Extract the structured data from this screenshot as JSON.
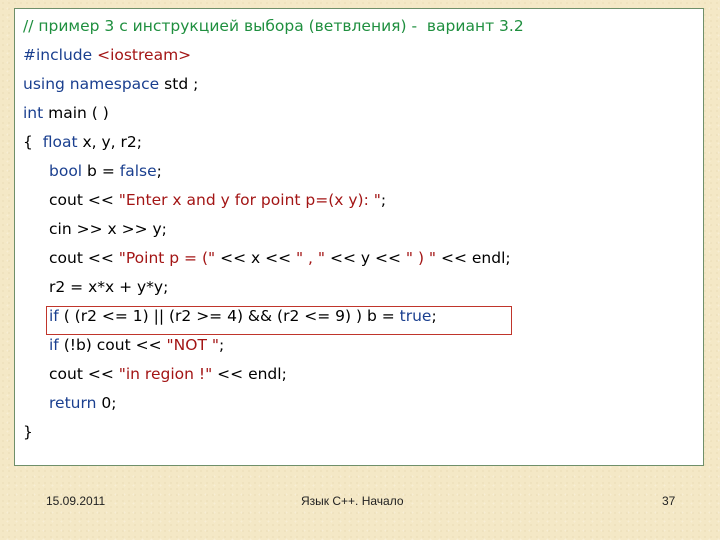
{
  "code": {
    "line1": {
      "comment": "// пример 3 с инструкцией выбора (ветвления) -  вариант 3.2"
    },
    "line2": {
      "pre": "#include",
      "lib": " <iostream>"
    },
    "line3": {
      "kw": "using namespace",
      "rest": " std ;"
    },
    "line4": {
      "kw": "int",
      "rest": " main ( )"
    },
    "line5": {
      "open": "{  ",
      "kw": "float",
      "rest": " x, y, r2;"
    },
    "line6": {
      "kw": "bool",
      "mid": " b = ",
      "kw2": "false",
      "rest": ";"
    },
    "line7": {
      "a": "cout << ",
      "str": "\"Enter x and y for point p=(x y): \"",
      "b": ";"
    },
    "line8": {
      "text": "cin >> x >> y;"
    },
    "line9": {
      "a": "cout << ",
      "s1": "\"Point p = (\"",
      "b": " << x << ",
      "s2": "\" , \"",
      "c": " << y << ",
      "s3": "\" ) \"",
      "d": " << endl;"
    },
    "line10": {
      "text": "r2 = x*x + y*y;"
    },
    "line11": {
      "kw": "if",
      "mid": " ( (r2 <= 1) || (r2 >= 4) && (r2 <= 9) ) b = ",
      "kw2": "true",
      "rest": ";"
    },
    "line12": {
      "kw": "if",
      "mid": " (!b) cout << ",
      "str": "\"NOT \"",
      "rest": ";"
    },
    "line13": {
      "a": "cout << ",
      "str": "\"in region !\"",
      "b": " << endl;"
    },
    "line14": {
      "kw": "return",
      "rest": " 0;"
    },
    "line15": {
      "text": "}"
    }
  },
  "footer": {
    "date": "15.09.2011",
    "title": "Язык С++. Начало",
    "page": "37"
  },
  "colors": {
    "background": "#f4e8c6",
    "comment": "#1f8f3f",
    "keyword": "#1a3f8f",
    "string": "#a31515",
    "highlight": "#c0352b"
  }
}
